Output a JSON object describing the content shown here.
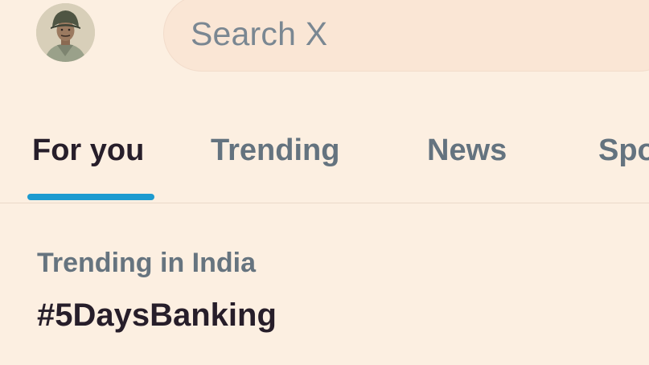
{
  "header": {
    "avatar_label": "",
    "search": {
      "placeholder": "Search X"
    }
  },
  "tabs": [
    {
      "label": "For you",
      "active": true
    },
    {
      "label": "Trending",
      "active": false
    },
    {
      "label": "News",
      "active": false
    },
    {
      "label": "Spo",
      "active": false
    }
  ],
  "trend": {
    "context": "Trending in India",
    "name": "#5DaysBanking"
  },
  "colors": {
    "background": "#fcefe1",
    "search_background": "#fae6d5",
    "active_tab_text": "#271e2a",
    "inactive_tab_text": "#64737f",
    "tab_indicator": "#1d9bd0",
    "secondary_text": "#66747f"
  }
}
